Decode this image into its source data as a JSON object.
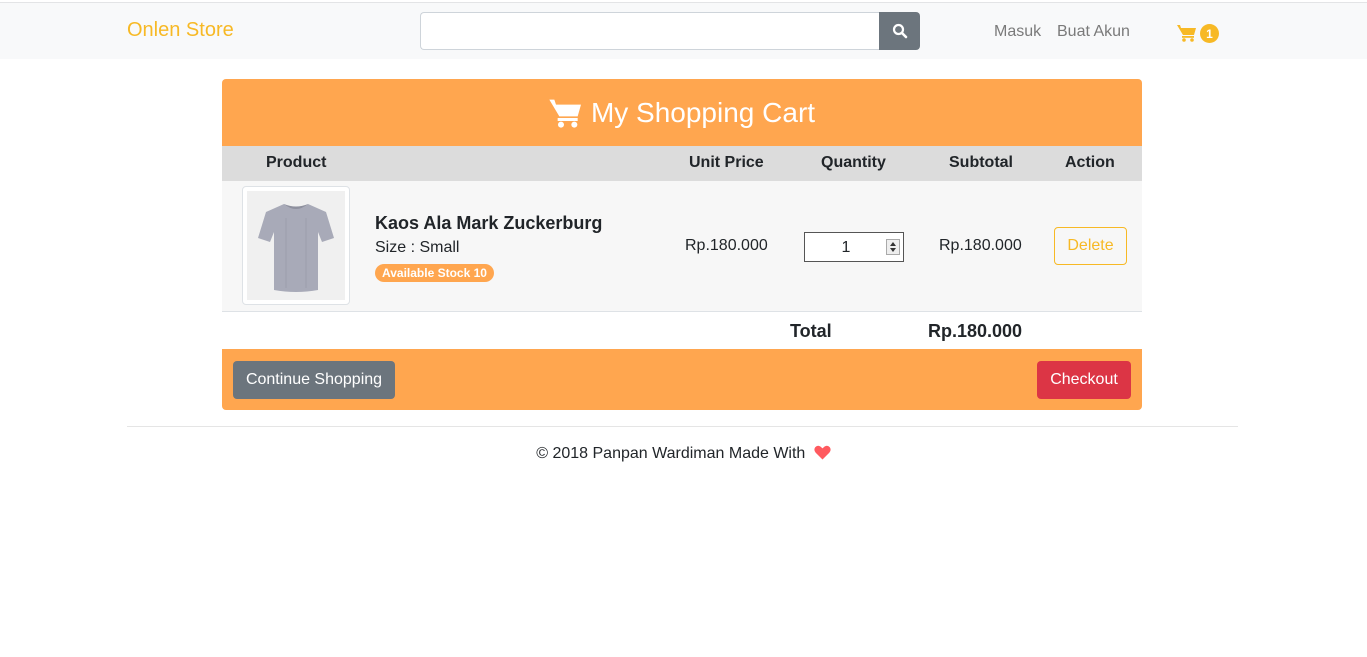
{
  "navbar": {
    "brand": "Onlen Store",
    "search": {
      "value": "",
      "placeholder": ""
    },
    "links": {
      "login": "Masuk",
      "register": "Buat Akun"
    },
    "cart_count": "1"
  },
  "cart": {
    "title": "My Shopping Cart",
    "columns": {
      "product": "Product",
      "unit_price": "Unit Price",
      "quantity": "Quantity",
      "subtotal": "Subtotal",
      "action": "Action"
    },
    "items": [
      {
        "name": "Kaos Ala Mark Zuckerburg",
        "size": "Size : Small",
        "stock": "Available Stock 10",
        "unit_price": "Rp.180.000",
        "quantity": "1",
        "subtotal": "Rp.180.000",
        "action": "Delete"
      }
    ],
    "total_label": "Total",
    "total_value": "Rp.180.000",
    "continue_label": "Continue Shopping",
    "checkout_label": "Checkout"
  },
  "footer": {
    "text": "© 2018 Panpan Wardiman Made With"
  },
  "colors": {
    "brand": "#f7b925",
    "header_orange": "#ffa64f",
    "checkout_red": "#dc3545",
    "secondary_gray": "#6c757d"
  },
  "icons": {
    "search": "search-icon",
    "cart": "shopping-cart-icon",
    "heart": "heart-icon"
  }
}
